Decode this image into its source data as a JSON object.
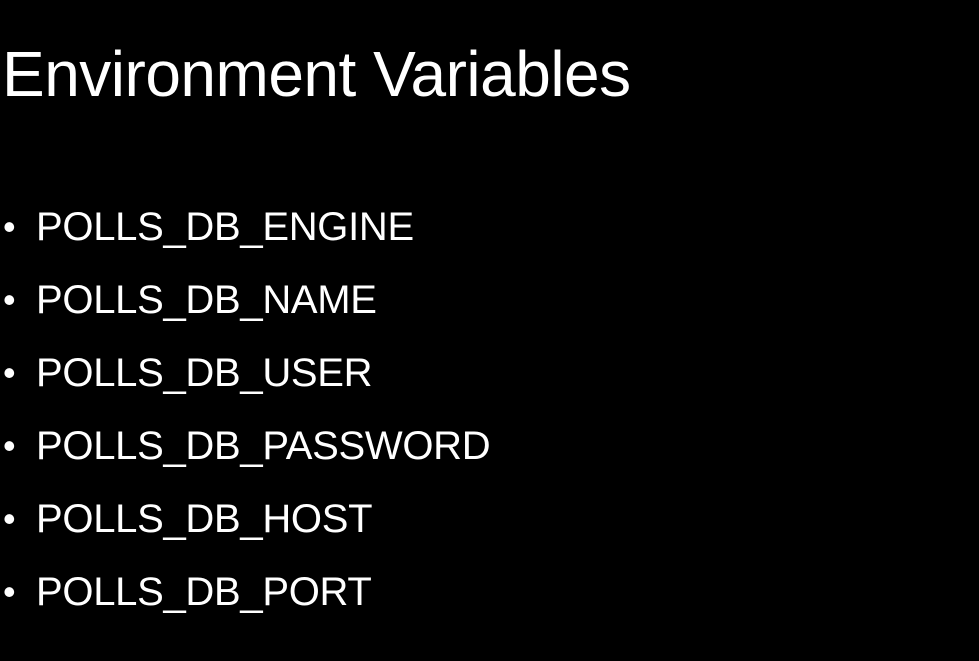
{
  "slide": {
    "title": "Environment Variables",
    "bullet_glyph": "•",
    "items": [
      {
        "label": "POLLS_DB_ENGINE"
      },
      {
        "label": "POLLS_DB_NAME"
      },
      {
        "label": "POLLS_DB_USER"
      },
      {
        "label": "POLLS_DB_PASSWORD"
      },
      {
        "label": "POLLS_DB_HOST"
      },
      {
        "label": "POLLS_DB_PORT"
      }
    ]
  },
  "colors": {
    "background": "#000000",
    "text": "#ffffff"
  }
}
